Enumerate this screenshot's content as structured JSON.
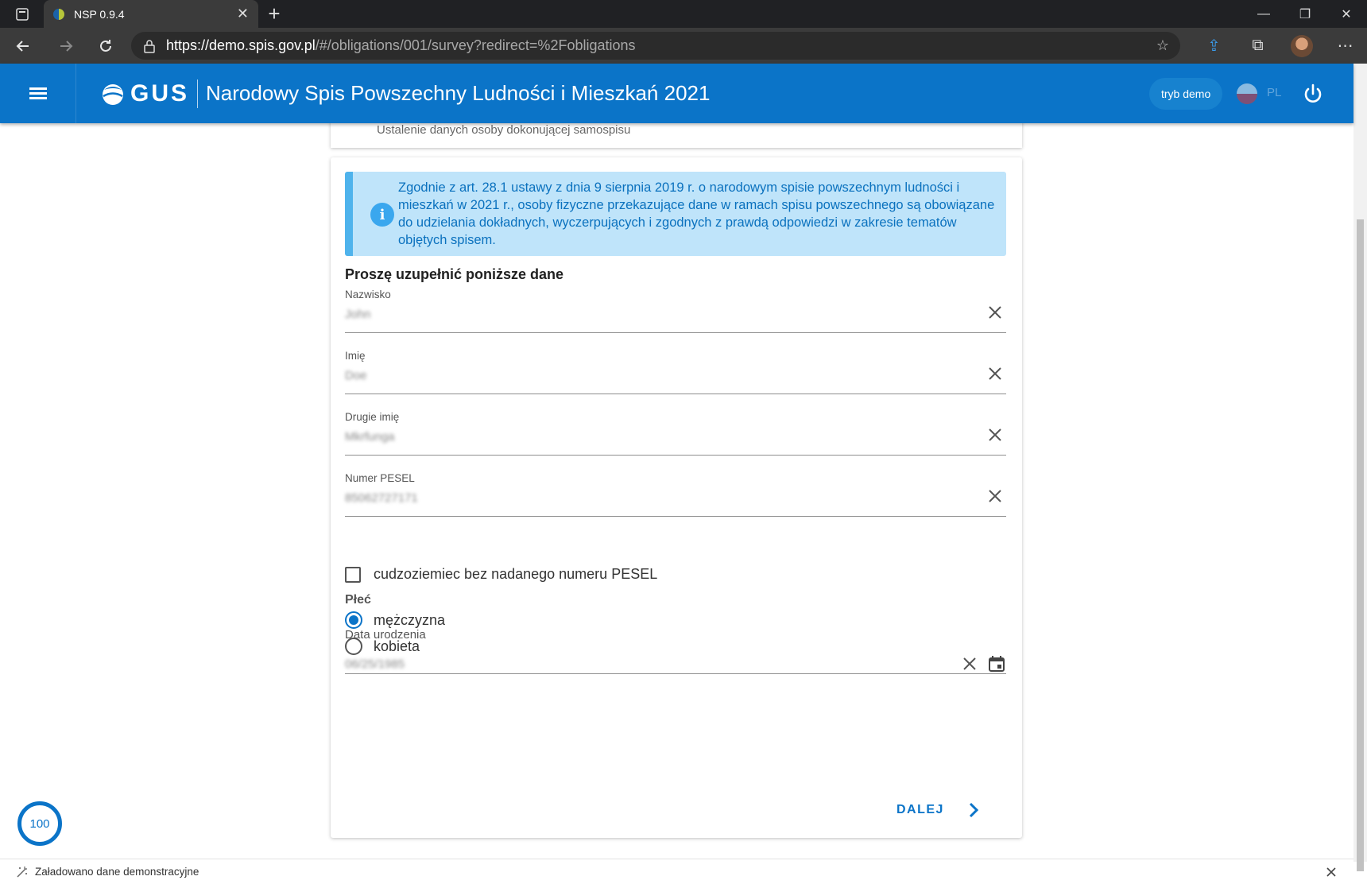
{
  "browser": {
    "tab_title": "NSP 0.9.4",
    "url_host": "https://demo.spis.gov.pl",
    "url_path": "/#/obligations/001/survey?redirect=%2Fobligations"
  },
  "header": {
    "logo_text": "GUS",
    "title": "Narodowy Spis Powszechny Ludności i Mieszkań 2021",
    "demo_label": "tryb demo",
    "lang": "PL"
  },
  "prev_card": {
    "subtitle": "Ustalenie danych osoby dokonującej samospisu"
  },
  "info": {
    "text": "Zgodnie z art. 28.1 ustawy z dnia 9 sierpnia 2019 r. o narodowym spisie powszechnym ludności i mieszkań w 2021 r., osoby fizyczne przekazujące dane w ramach spisu powszechnego są obowiązane do udzielania dokładnych, wyczerpujących i zgodnych z prawdą odpowiedzi w zakresie tematów objętych spisem."
  },
  "form": {
    "section_title": "Proszę uzupełnić poniższe dane",
    "fields": [
      {
        "label": "Nazwisko",
        "value": "John"
      },
      {
        "label": "Imię",
        "value": "Doe"
      },
      {
        "label": "Drugie imię",
        "value": "Mkrfunga"
      },
      {
        "label": "Numer PESEL",
        "value": "85062727171"
      }
    ],
    "foreigner_checkbox": "cudzoziemiec bez nadanego numeru PESEL",
    "gender_label": "Płeć",
    "gender_options": [
      "mężczyzna",
      "kobieta"
    ],
    "gender_selected": "mężczyzna",
    "birthdate_label": "Data urodzenia",
    "birthdate_value": "06/25/1985",
    "next_button": "DALEJ"
  },
  "progress_value": "100",
  "notice": {
    "text": "Załadowano dane demonstracyjne"
  },
  "colors": {
    "primary": "#0b74c8",
    "info_bg": "#bfe4fa",
    "info_text": "#0a71be"
  }
}
